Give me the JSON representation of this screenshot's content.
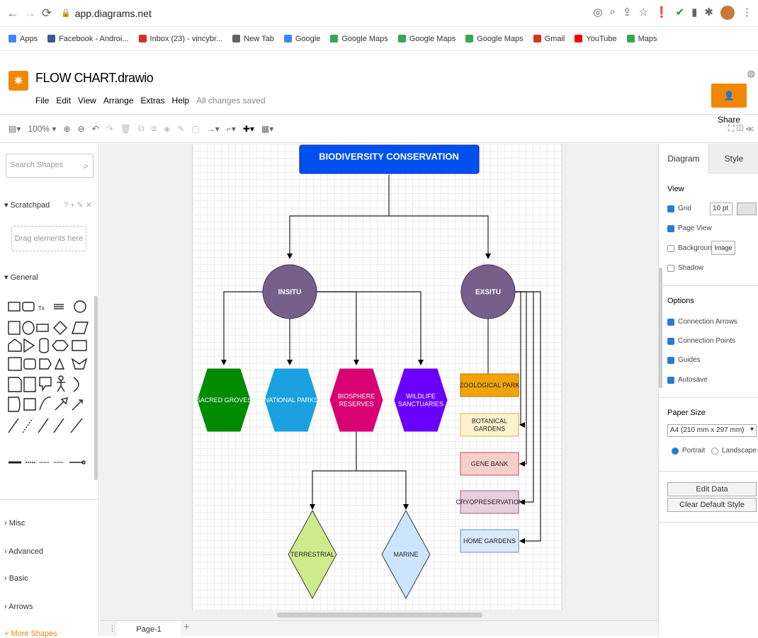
{
  "browser": {
    "url": "app.diagrams.net",
    "bookmarks": [
      {
        "label": "Apps",
        "color": "#4285f4"
      },
      {
        "label": "Facebook - Androi...",
        "color": "#3b5998"
      },
      {
        "label": "Inbox (23) - vincybr...",
        "color": "#d93025"
      },
      {
        "label": "New Tab",
        "color": "#5f6368"
      },
      {
        "label": "Google",
        "color": "#4285f4"
      },
      {
        "label": "Google Maps",
        "color": "#34a853"
      },
      {
        "label": "Google Maps",
        "color": "#34a853"
      },
      {
        "label": "Google Maps",
        "color": "#34a853"
      },
      {
        "label": "Gmail",
        "color": "#d93025"
      },
      {
        "label": "YouTube",
        "color": "#ff0000"
      },
      {
        "label": "Maps",
        "color": "#34a853"
      }
    ]
  },
  "app": {
    "doc_title": "FLOW CHART.drawio",
    "menu": [
      "File",
      "Edit",
      "View",
      "Arrange",
      "Extras",
      "Help"
    ],
    "save_status": "All changes saved",
    "share_label": "Share",
    "zoom": "100%"
  },
  "sidebar": {
    "search_placeholder": "Search Shapes",
    "scratchpad": "Scratchpad",
    "scratch_tools": "? + ✎ ✕",
    "drop_hint": "Drag elements here",
    "general": "General",
    "sections": [
      "Misc",
      "Advanced",
      "Basic",
      "Arrows"
    ],
    "more_shapes": "+ More Shapes"
  },
  "pages": {
    "current": "Page-1"
  },
  "diagram": {
    "title": "BIODIVERSITY CONSERVATION",
    "insitu": "INSITU",
    "exsitu": "EXSITU",
    "insitu_children": [
      {
        "label": [
          "SACRED GROVES"
        ],
        "color": "#008a00"
      },
      {
        "label": [
          "NATIONAL PARKS"
        ],
        "color": "#1ba1e2"
      },
      {
        "label": [
          "BIOSPHERE",
          "RESERVES"
        ],
        "color": "#d80073"
      },
      {
        "label": [
          "WILDLIFE",
          "SANCTUARIES"
        ],
        "color": "#6a00ff"
      }
    ],
    "biosphere_children": [
      {
        "label": "TERRESTRIAL",
        "color": "#cdeb8b",
        "stroke": "#36393d"
      },
      {
        "label": "MARINE",
        "color": "#cce5ff",
        "stroke": "#36393d"
      }
    ],
    "exsitu_children": [
      {
        "label": [
          "ZOOLOGICAL PARK"
        ],
        "color": "#f0a30a",
        "stroke": "#bd7000"
      },
      {
        "label": [
          "BOTANICAL",
          "GARDENS"
        ],
        "color": "#fff2cc",
        "stroke": "#d6b656"
      },
      {
        "label": [
          "GENE BANK"
        ],
        "color": "#f8cecc",
        "stroke": "#b85450"
      },
      {
        "label": [
          "CRYOPRESERVATION"
        ],
        "color": "#e6d0de",
        "stroke": "#996185"
      },
      {
        "label": [
          "HOME GARDENS"
        ],
        "color": "#dae8fc",
        "stroke": "#6c8ebf"
      }
    ],
    "title_color": "#0050ef",
    "circle_color": "#76608a"
  },
  "format_panel": {
    "tabs": [
      "Diagram",
      "Style"
    ],
    "view_label": "View",
    "view_options": [
      {
        "label": "Grid",
        "checked": true
      },
      {
        "label": "Page View",
        "checked": true
      },
      {
        "label": "Background",
        "checked": false
      },
      {
        "label": "Shadow",
        "checked": false
      }
    ],
    "grid_size": "10 pt",
    "image_button": "Image",
    "options_label": "Options",
    "options": [
      {
        "label": "Connection Arrows",
        "checked": true
      },
      {
        "label": "Connection Points",
        "checked": true
      },
      {
        "label": "Guides",
        "checked": true
      },
      {
        "label": "Autosave",
        "checked": true
      }
    ],
    "paper_size_label": "Paper Size",
    "paper_size": "A4 (210 mm x 297 mm)",
    "orientation": [
      {
        "label": "Portrait",
        "checked": true
      },
      {
        "label": "Landscape",
        "checked": false
      }
    ],
    "edit_data": "Edit Data",
    "clear_style": "Clear Default Style"
  }
}
